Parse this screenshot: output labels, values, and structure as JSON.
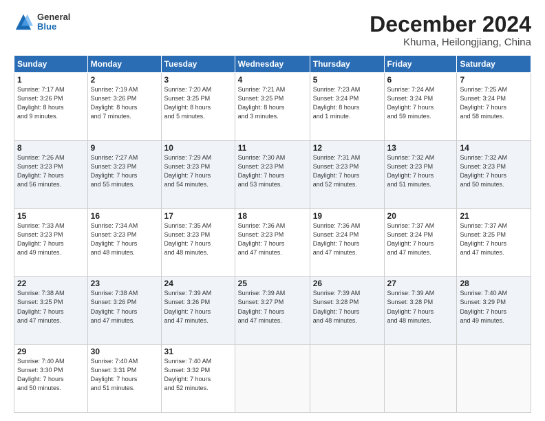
{
  "header": {
    "logo_general": "General",
    "logo_blue": "Blue",
    "month": "December 2024",
    "location": "Khuma, Heilongjiang, China"
  },
  "days_of_week": [
    "Sunday",
    "Monday",
    "Tuesday",
    "Wednesday",
    "Thursday",
    "Friday",
    "Saturday"
  ],
  "weeks": [
    [
      {
        "day": "1",
        "info": "Sunrise: 7:17 AM\nSunset: 3:26 PM\nDaylight: 8 hours\nand 9 minutes."
      },
      {
        "day": "2",
        "info": "Sunrise: 7:19 AM\nSunset: 3:26 PM\nDaylight: 8 hours\nand 7 minutes."
      },
      {
        "day": "3",
        "info": "Sunrise: 7:20 AM\nSunset: 3:25 PM\nDaylight: 8 hours\nand 5 minutes."
      },
      {
        "day": "4",
        "info": "Sunrise: 7:21 AM\nSunset: 3:25 PM\nDaylight: 8 hours\nand 3 minutes."
      },
      {
        "day": "5",
        "info": "Sunrise: 7:23 AM\nSunset: 3:24 PM\nDaylight: 8 hours\nand 1 minute."
      },
      {
        "day": "6",
        "info": "Sunrise: 7:24 AM\nSunset: 3:24 PM\nDaylight: 7 hours\nand 59 minutes."
      },
      {
        "day": "7",
        "info": "Sunrise: 7:25 AM\nSunset: 3:24 PM\nDaylight: 7 hours\nand 58 minutes."
      }
    ],
    [
      {
        "day": "8",
        "info": "Sunrise: 7:26 AM\nSunset: 3:23 PM\nDaylight: 7 hours\nand 56 minutes."
      },
      {
        "day": "9",
        "info": "Sunrise: 7:27 AM\nSunset: 3:23 PM\nDaylight: 7 hours\nand 55 minutes."
      },
      {
        "day": "10",
        "info": "Sunrise: 7:29 AM\nSunset: 3:23 PM\nDaylight: 7 hours\nand 54 minutes."
      },
      {
        "day": "11",
        "info": "Sunrise: 7:30 AM\nSunset: 3:23 PM\nDaylight: 7 hours\nand 53 minutes."
      },
      {
        "day": "12",
        "info": "Sunrise: 7:31 AM\nSunset: 3:23 PM\nDaylight: 7 hours\nand 52 minutes."
      },
      {
        "day": "13",
        "info": "Sunrise: 7:32 AM\nSunset: 3:23 PM\nDaylight: 7 hours\nand 51 minutes."
      },
      {
        "day": "14",
        "info": "Sunrise: 7:32 AM\nSunset: 3:23 PM\nDaylight: 7 hours\nand 50 minutes."
      }
    ],
    [
      {
        "day": "15",
        "info": "Sunrise: 7:33 AM\nSunset: 3:23 PM\nDaylight: 7 hours\nand 49 minutes."
      },
      {
        "day": "16",
        "info": "Sunrise: 7:34 AM\nSunset: 3:23 PM\nDaylight: 7 hours\nand 48 minutes."
      },
      {
        "day": "17",
        "info": "Sunrise: 7:35 AM\nSunset: 3:23 PM\nDaylight: 7 hours\nand 48 minutes."
      },
      {
        "day": "18",
        "info": "Sunrise: 7:36 AM\nSunset: 3:23 PM\nDaylight: 7 hours\nand 47 minutes."
      },
      {
        "day": "19",
        "info": "Sunrise: 7:36 AM\nSunset: 3:24 PM\nDaylight: 7 hours\nand 47 minutes."
      },
      {
        "day": "20",
        "info": "Sunrise: 7:37 AM\nSunset: 3:24 PM\nDaylight: 7 hours\nand 47 minutes."
      },
      {
        "day": "21",
        "info": "Sunrise: 7:37 AM\nSunset: 3:25 PM\nDaylight: 7 hours\nand 47 minutes."
      }
    ],
    [
      {
        "day": "22",
        "info": "Sunrise: 7:38 AM\nSunset: 3:25 PM\nDaylight: 7 hours\nand 47 minutes."
      },
      {
        "day": "23",
        "info": "Sunrise: 7:38 AM\nSunset: 3:26 PM\nDaylight: 7 hours\nand 47 minutes."
      },
      {
        "day": "24",
        "info": "Sunrise: 7:39 AM\nSunset: 3:26 PM\nDaylight: 7 hours\nand 47 minutes."
      },
      {
        "day": "25",
        "info": "Sunrise: 7:39 AM\nSunset: 3:27 PM\nDaylight: 7 hours\nand 47 minutes."
      },
      {
        "day": "26",
        "info": "Sunrise: 7:39 AM\nSunset: 3:28 PM\nDaylight: 7 hours\nand 48 minutes."
      },
      {
        "day": "27",
        "info": "Sunrise: 7:39 AM\nSunset: 3:28 PM\nDaylight: 7 hours\nand 48 minutes."
      },
      {
        "day": "28",
        "info": "Sunrise: 7:40 AM\nSunset: 3:29 PM\nDaylight: 7 hours\nand 49 minutes."
      }
    ],
    [
      {
        "day": "29",
        "info": "Sunrise: 7:40 AM\nSunset: 3:30 PM\nDaylight: 7 hours\nand 50 minutes."
      },
      {
        "day": "30",
        "info": "Sunrise: 7:40 AM\nSunset: 3:31 PM\nDaylight: 7 hours\nand 51 minutes."
      },
      {
        "day": "31",
        "info": "Sunrise: 7:40 AM\nSunset: 3:32 PM\nDaylight: 7 hours\nand 52 minutes."
      },
      null,
      null,
      null,
      null
    ]
  ]
}
